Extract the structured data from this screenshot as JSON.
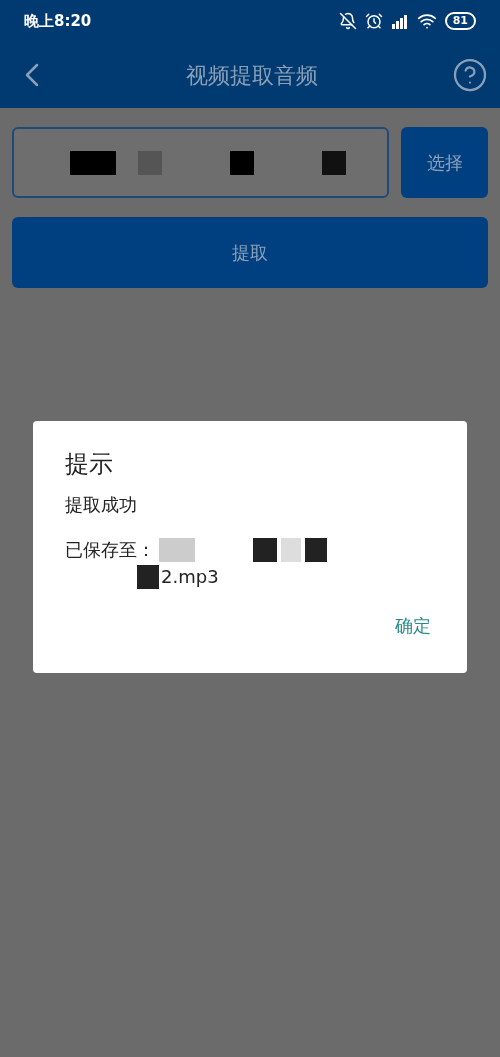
{
  "status_bar": {
    "time": "晚上8:20",
    "battery": "81"
  },
  "header": {
    "title": "视频提取音频"
  },
  "select_button": "选择",
  "extract_button": "提取",
  "dialog": {
    "title": "提示",
    "message": "提取成功",
    "path_label": "已保存至：",
    "path_end": "2.mp3",
    "confirm": "确定"
  }
}
